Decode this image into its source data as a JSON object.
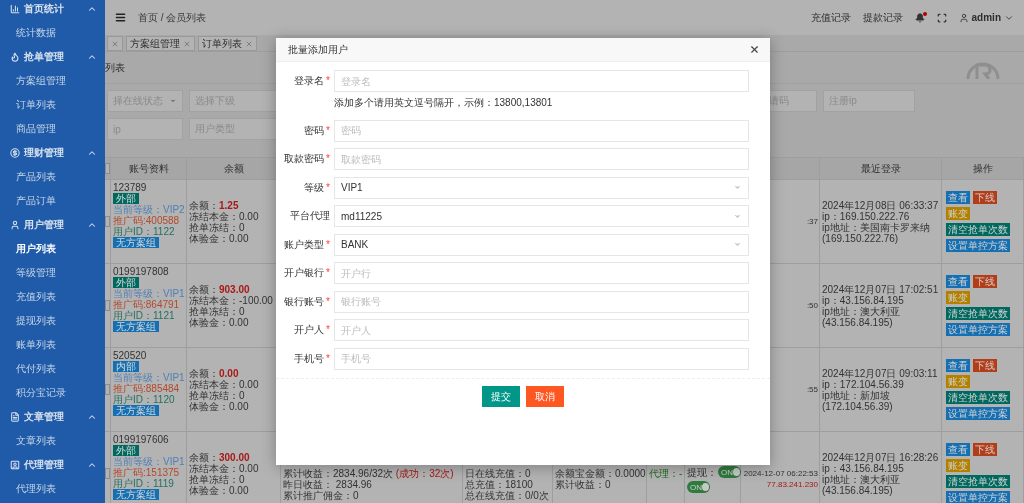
{
  "sidebar": {
    "groups": [
      {
        "title": "首页统计",
        "expanded": true,
        "items": [
          {
            "label": "统计数据",
            "selected": false
          }
        ]
      },
      {
        "title": "抢单管理",
        "expanded": true,
        "items": [
          {
            "label": "方案组管理",
            "selected": false
          },
          {
            "label": "订单列表",
            "selected": false
          },
          {
            "label": "商品管理",
            "selected": false
          }
        ]
      },
      {
        "title": "理财管理",
        "expanded": true,
        "items": [
          {
            "label": "产品列表",
            "selected": false
          },
          {
            "label": "产品订单",
            "selected": false
          }
        ]
      },
      {
        "title": "用户管理",
        "expanded": true,
        "items": [
          {
            "label": "用户列表",
            "selected": true
          },
          {
            "label": "等级管理",
            "selected": false
          },
          {
            "label": "充值列表",
            "selected": false
          },
          {
            "label": "提现列表",
            "selected": false
          },
          {
            "label": "账单列表",
            "selected": false
          },
          {
            "label": "代付列表",
            "selected": false
          },
          {
            "label": "积分宝记录",
            "selected": false
          }
        ]
      },
      {
        "title": "文章管理",
        "expanded": true,
        "items": [
          {
            "label": "文章列表",
            "selected": false
          }
        ]
      },
      {
        "title": "代理管理",
        "expanded": true,
        "items": [
          {
            "label": "代理列表",
            "selected": false
          }
        ]
      }
    ]
  },
  "topbar": {
    "breadcrumb": "首页 / 会员列表",
    "links": [
      "充值记录",
      "提款记录"
    ],
    "notification": true,
    "user": "admin"
  },
  "tabs": [
    {
      "selected": false
    },
    {
      "label": "方案组管理",
      "selected": false
    },
    {
      "label": "订单列表",
      "selected": false
    }
  ],
  "page_title": "列表",
  "filter_rows": [
    {
      "left": [
        {
          "kind": "select",
          "placeholder": "择在线状态"
        },
        {
          "kind": "input",
          "placeholder": "选择下级"
        }
      ],
      "right": [
        {
          "placeholder": "请码"
        },
        {
          "placeholder": "注册ip"
        }
      ]
    },
    {
      "left": [
        {
          "kind": "input",
          "placeholder": "ip"
        },
        {
          "kind": "input",
          "placeholder": "用户类型"
        }
      ],
      "right": []
    }
  ],
  "table": {
    "all_checked": false,
    "columns": {
      "account": "账号资料",
      "balance": "余额",
      "last_login": "最近登录",
      "actions": "操作"
    },
    "rows": [
      {
        "checked": false,
        "account": {
          "name": "123789",
          "tag": {
            "label": "外部",
            "color": "#00695f"
          },
          "level": "当前等级：VIP2",
          "promo": "推广码:400588",
          "uid": "用户ID：1122",
          "plan": "无方案组"
        },
        "balance": {
          "label": "余额：",
          "value": "1.25",
          "lines": [
            "冻结本金：0.00",
            "抢单冻结：0",
            "体验金：0.00"
          ]
        },
        "register": [
          ":37"
        ],
        "last_login": [
          "2024年12月08日 06:33:37",
          "ip：169.150.222.76",
          "ip地址：美国南卡罗来纳",
          "(169.150.222.76)"
        ],
        "actions": [
          {
            "label": "查看",
            "color": "#156fb3"
          },
          {
            "label": "下线",
            "color": "#b33d18"
          },
          {
            "label": "账变",
            "color": "#b38100"
          },
          {
            "label": "清空抢单次数",
            "color": "#00695f"
          },
          {
            "label": "设置单控方案",
            "color": "#156fb3"
          }
        ]
      },
      {
        "checked": false,
        "account": {
          "name": "0199197808",
          "tag": {
            "label": "外部",
            "color": "#00695f"
          },
          "level": "当前等级：VIP1",
          "promo": "推广码:864791",
          "uid": "用户ID：1121",
          "plan": "无方案组"
        },
        "balance": {
          "label": "余额：",
          "value": "903.00",
          "lines": [
            "冻结本金：-100.00",
            "抢单冻结：0",
            "体验金：0.00"
          ]
        },
        "register": [
          ":50"
        ],
        "last_login": [
          "2024年12月07日 17:02:51",
          "ip：43.156.84.195",
          "ip地址：澳大利亚",
          "(43.156.84.195)"
        ],
        "actions": [
          {
            "label": "查看",
            "color": "#156fb3"
          },
          {
            "label": "下线",
            "color": "#b33d18"
          },
          {
            "label": "账变",
            "color": "#b38100"
          },
          {
            "label": "清空抢单次数",
            "color": "#00695f"
          },
          {
            "label": "设置单控方案",
            "color": "#156fb3"
          }
        ]
      },
      {
        "checked": false,
        "account": {
          "name": "520520",
          "tag": {
            "label": "内部",
            "color": "#156fb3"
          },
          "level": "当前等级：VIP1",
          "promo": "推广码:885484",
          "uid": "用户ID：1120",
          "plan": "无方案组"
        },
        "balance": {
          "label": "余额：",
          "value": "0.00",
          "lines": [
            "冻结本金：0.00",
            "抢单冻结：0",
            "体验金：0.00"
          ]
        },
        "register": [
          ":55"
        ],
        "last_login": [
          "2024年12月07日 09:03:11",
          "ip：172.104.56.39",
          "ip地址：新加坡",
          "(172.104.56.39)"
        ],
        "actions": [
          {
            "label": "查看",
            "color": "#156fb3"
          },
          {
            "label": "下线",
            "color": "#b33d18"
          },
          {
            "label": "账变",
            "color": "#b38100"
          },
          {
            "label": "清空抢单次数",
            "color": "#00695f"
          },
          {
            "label": "设置单控方案",
            "color": "#156fb3"
          }
        ]
      },
      {
        "checked": false,
        "account": {
          "name": "0199197606",
          "tag": {
            "label": "外部",
            "color": "#00695f"
          },
          "level": "当前等级：VIP1",
          "promo": "推广码:151375",
          "uid": "用户ID：1119",
          "plan": "无方案组"
        },
        "balance": {
          "label": "余额：",
          "value": "300.00",
          "lines": [
            "冻结本金：0.00",
            "抢单冻结：0",
            "体验金：0.00"
          ]
        },
        "stats": {
          "lines": [
            "累计收益：2834.96/32次",
            "昨日收益： 2834.96",
            "累计推广佣金：0"
          ],
          "success": "(成功：32次)"
        },
        "recharge": [
          "日在线充值：0",
          "总充值：18100",
          "总在线充值：0/0次"
        ],
        "yuebao": [
          "余额宝金额：0.0000",
          "累计收益：0"
        ],
        "agent": "代理：-",
        "switches": [
          {
            "label": "提现：",
            "on": true,
            "text": "ON"
          },
          {
            "on": true,
            "text": "ON"
          }
        ],
        "register": [
          "2024-12-07 06:22:53"
        ],
        "register_ip": "77.83.241.230",
        "last_login": [
          "2024年12月07日 16:28:26",
          "ip：43.156.84.195",
          "ip地址：澳大利亚",
          "(43.156.84.195)"
        ],
        "actions": [
          {
            "label": "查看",
            "color": "#156fb3"
          },
          {
            "label": "下线",
            "color": "#b33d18"
          },
          {
            "label": "账变",
            "color": "#b38100"
          },
          {
            "label": "清空抢单次数",
            "color": "#00695f"
          },
          {
            "label": "设置单控方案",
            "color": "#156fb3"
          }
        ]
      }
    ]
  },
  "dialog": {
    "title": "批量添加用户",
    "fields": [
      {
        "label": "登录名",
        "star": "*",
        "kind": "input",
        "placeholder": "登录名",
        "hint": "添加多个请用英文逗号隔开，示例：13800,13801"
      },
      {
        "label": "密码",
        "star": "*",
        "kind": "input",
        "placeholder": "密码"
      },
      {
        "label": "取款密码",
        "star": "*",
        "kind": "input",
        "placeholder": "取款密码"
      },
      {
        "label": "等级",
        "star": "*",
        "kind": "select",
        "value": "VIP1"
      },
      {
        "label": "平台代理",
        "kind": "select",
        "value": "md11225"
      },
      {
        "label": "账户类型",
        "star": "*",
        "kind": "select",
        "value": "BANK"
      },
      {
        "label": "开户银行",
        "star": "*",
        "kind": "input",
        "placeholder": "开户行"
      },
      {
        "label": "银行账号",
        "star": "*",
        "kind": "input",
        "placeholder": "银行账号"
      },
      {
        "label": "开户人",
        "star": "*",
        "kind": "input",
        "placeholder": "开户人"
      },
      {
        "label": "手机号",
        "star": "*",
        "kind": "input",
        "placeholder": "手机号"
      }
    ],
    "buttons": [
      {
        "label": "提交",
        "kind": "primary"
      },
      {
        "label": "取消",
        "kind": "danger"
      }
    ]
  }
}
